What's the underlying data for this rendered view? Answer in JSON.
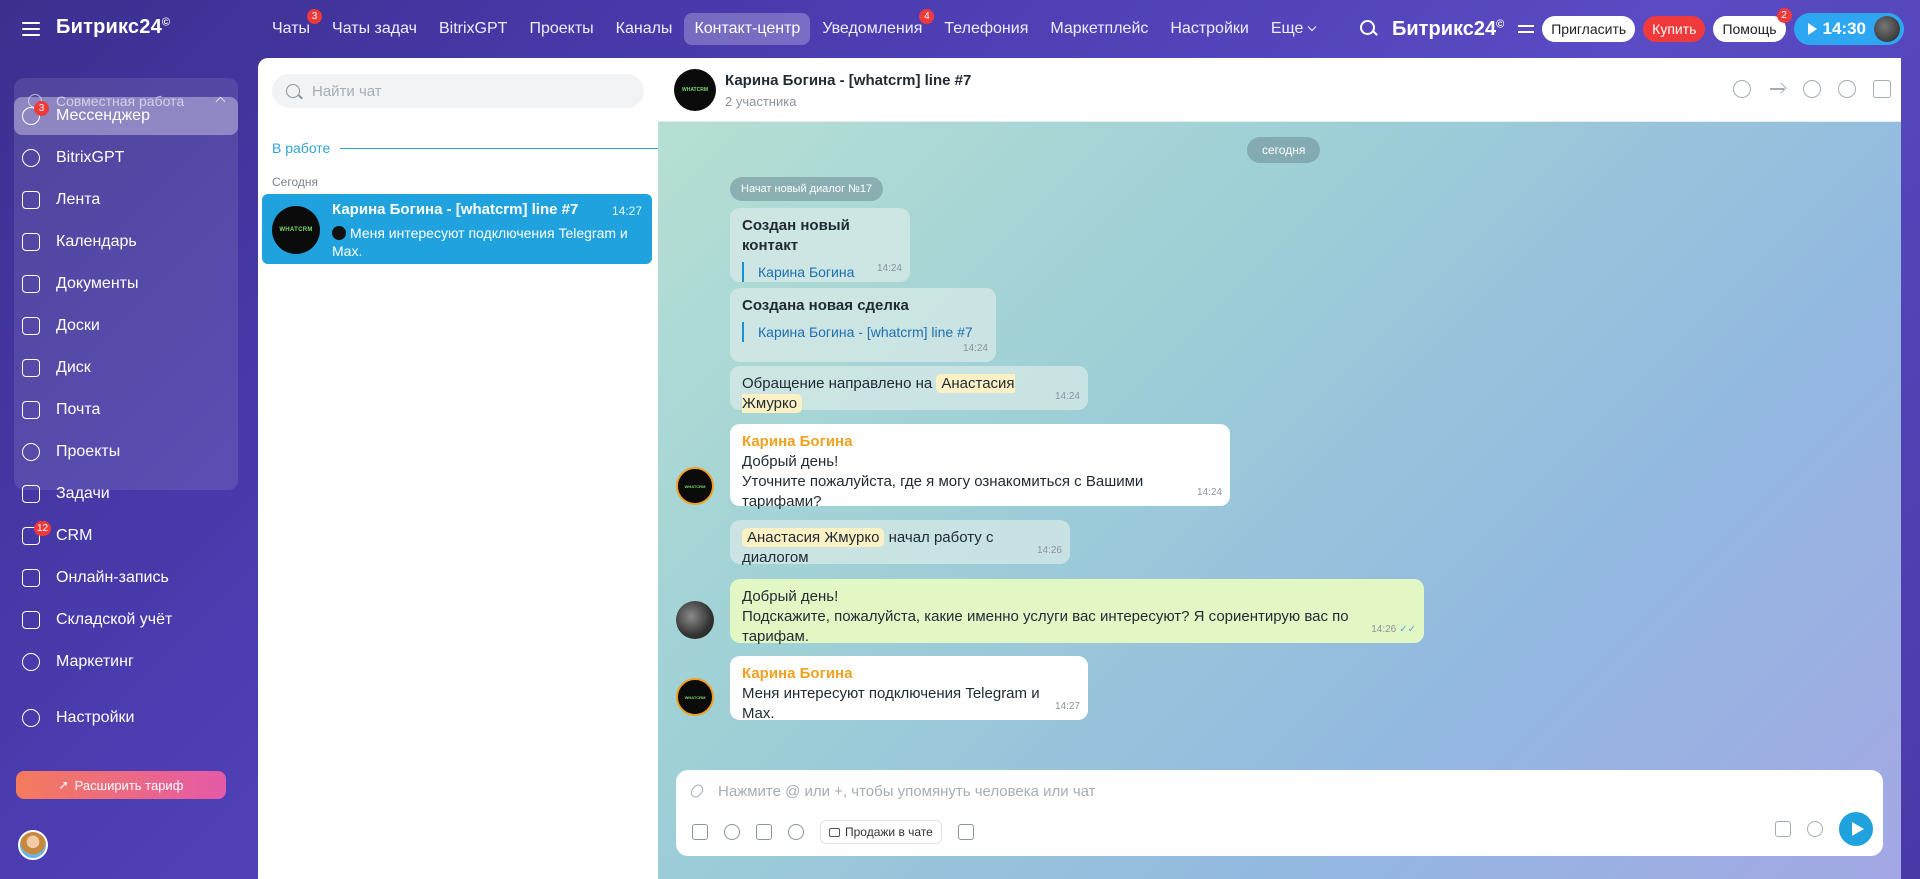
{
  "topbar": {
    "logo": "Битрикс24",
    "logo_mark": "©",
    "nav": [
      {
        "label": "Чаты",
        "badge": "3"
      },
      {
        "label": "Чаты задач"
      },
      {
        "label": "BitrixGPT"
      },
      {
        "label": "Проекты"
      },
      {
        "label": "Каналы"
      },
      {
        "label": "Контакт-центр",
        "active": true
      },
      {
        "label": "Уведомления",
        "badge": "4"
      },
      {
        "label": "Телефония"
      },
      {
        "label": "Маркетплейс"
      },
      {
        "label": "Настройки"
      },
      {
        "label": "Еще"
      }
    ],
    "invite": "Пригласить",
    "buy": "Купить",
    "help": "Помощь",
    "help_badge": "2",
    "timer": "14:30"
  },
  "sidebar": {
    "group_title": "Совместная работа",
    "items": [
      {
        "label": "Мессенджер",
        "badge": "3",
        "active": true
      },
      {
        "label": "BitrixGPT"
      },
      {
        "label": "Лента"
      },
      {
        "label": "Календарь"
      },
      {
        "label": "Документы"
      },
      {
        "label": "Доски"
      },
      {
        "label": "Диск"
      },
      {
        "label": "Почта"
      },
      {
        "label": "Проекты"
      },
      {
        "label": "Задачи"
      },
      {
        "label": "CRM",
        "badge": "12"
      },
      {
        "label": "Онлайн-запись"
      },
      {
        "label": "Складской учёт"
      },
      {
        "label": "Маркетинг"
      },
      {
        "label": "Настройки"
      }
    ],
    "upgrade": "Расширить тариф"
  },
  "chatlist": {
    "search_placeholder": "Найти чат",
    "section": "В работе",
    "today": "Сегодня",
    "chats": [
      {
        "name": "Карина Богина - [whatcrm] line #7",
        "time": "14:27",
        "preview": "Меня интересуют подключения Telegram и Max.",
        "avatar_text": "WHATCRM"
      }
    ]
  },
  "chat": {
    "title": "Карина Богина - [whatcrm] line #7",
    "subtitle": "2 участника",
    "date": "сегодня",
    "dialog_started": "Начат новый диалог №17",
    "messages": {
      "m1": {
        "title": "Создан новый контакт",
        "quote": "Карина Богина",
        "time": "14:24"
      },
      "m2": {
        "title": "Создана новая сделка",
        "quote": "Карина Богина - [whatcrm] line #7",
        "time": "14:24"
      },
      "m3": {
        "text": "Обращение направлено на",
        "name": "Анастасия Жмурко",
        "time": "14:24"
      },
      "m4": {
        "author": "Карина Богина",
        "line1": "Добрый день!",
        "line2": "Уточните пожалуйста, где я могу ознакомиться с Вашими тарифами?",
        "time": "14:24"
      },
      "m5": {
        "name": "Анастасия Жмурко",
        "text": "начал работу с диалогом",
        "time": "14:26"
      },
      "m6": {
        "line1": "Добрый день!",
        "line2": "Подскажите, пожалуйста, какие именно услуги вас интересуют? Я сориентирую вас по тарифам.",
        "time": "14:26"
      },
      "m7": {
        "author": "Карина Богина",
        "text": "Меня интересуют подключения Telegram и Max.",
        "time": "14:27"
      }
    },
    "composer_placeholder": "Нажмите @ или +, чтобы упомянуть человека или чат",
    "sales_button": "Продажи в чате"
  }
}
